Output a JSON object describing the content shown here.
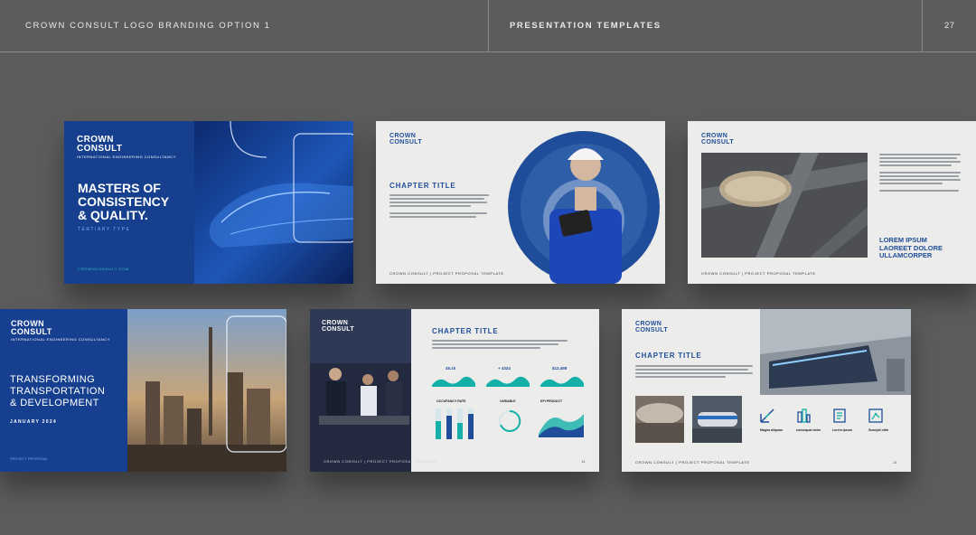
{
  "header": {
    "title": "CROWN CONSULT LOGO BRANDING OPTION 1",
    "section": "PRESENTATION TEMPLATES",
    "page_number": "27"
  },
  "brand": {
    "logo_line1": "CROWN",
    "logo_line2": "CONSULT",
    "tagline": "INTERNATIONAL ENGINEERING CONSULTANCY",
    "navy": "#1a3f8c",
    "teal": "#14b0a8"
  },
  "slide1": {
    "headline_1": "MASTERS OF",
    "headline_2": "CONSISTENCY",
    "headline_3": "& QUALITY.",
    "subline": "TERTIARY TYPE",
    "footer": "CROWNCONSULT.COM"
  },
  "slide2": {
    "chapter_title": "CHAPTER TITLE",
    "footer": "CROWN CONSULT | PROJECT PROPOSAL TEMPLATE"
  },
  "slide3": {
    "headline_1": "LOREM IPSUM",
    "headline_2": "LAOREET DOLORE",
    "headline_3": "ULLAMCORPER",
    "footer": "CROWN CONSULT | PROJECT PROPOSAL TEMPLATE"
  },
  "slide4": {
    "headline_1": "TRANSFORMING",
    "headline_2": "TRANSPORTATION",
    "headline_3": "& DEVELOPMENT",
    "date": "JANUARY 2024",
    "footer": "PROJECT PROPOSAL"
  },
  "slide5": {
    "chapter_title": "CHAPTER TITLE",
    "stats": [
      "45.1k",
      "+ 4324",
      "$12,498"
    ],
    "panel_titles": [
      "OCCUPANCY RATE",
      "VARIABLE",
      "KPI PRODUCT"
    ],
    "footer": "CROWN CONSULT | PROJECT PROPOSAL TEMPLATE",
    "page": "14"
  },
  "slide6": {
    "chapter_title": "CHAPTER TITLE",
    "features": [
      "Magna aliquam",
      "consequat dolor",
      "Lorem ipsum",
      "Suscipit nibh"
    ],
    "footer": "CROWN CONSULT | PROJECT PROPOSAL TEMPLATE",
    "page": "14"
  }
}
